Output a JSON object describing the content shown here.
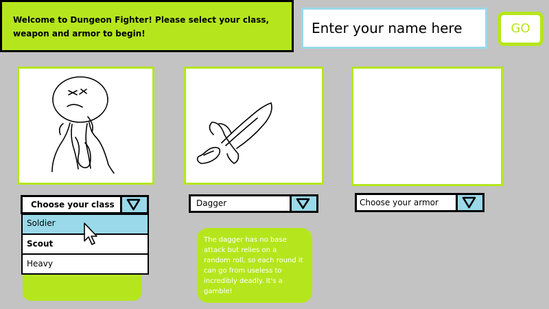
{
  "header": {
    "welcome_text": "Welcome to Dungeon Fighter! Please select your class, weapon and armor to begin!",
    "name_input_placeholder": "Enter your name here",
    "go_label": "GO"
  },
  "class_select": {
    "selected": "Choose your class",
    "options": [
      "Soldier",
      "Scout",
      "Heavy"
    ],
    "highlighted_option": "Soldier"
  },
  "weapon_select": {
    "selected": "Dagger",
    "description": "The dagger has no base attack but relies on a random roll, so each round it can go from useless to incredibly deadly. It's a gamble!"
  },
  "armor_select": {
    "selected": "Choose your armor"
  },
  "icons": {
    "dropdown_arrow": "triangle-down-icon",
    "pointer": "mouse-cursor-icon"
  },
  "colors": {
    "background": "#c3c3c3",
    "accent_green": "#b5e61d",
    "accent_blue": "#99d9ea"
  }
}
